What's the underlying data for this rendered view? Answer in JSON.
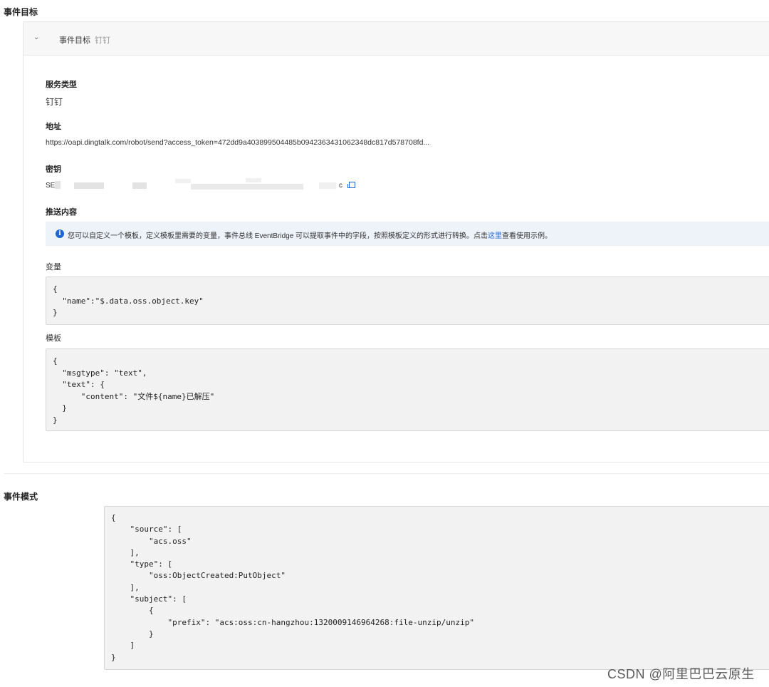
{
  "target_section": {
    "title": "事件目标",
    "panel": {
      "header_title": "事件目标",
      "header_sub": "钉钉",
      "service_type_label": "服务类型",
      "service_type_value": "钉钉",
      "address_label": "地址",
      "address_value": "https://oapi.dingtalk.com/robot/send?access_token=472dd9a403899504485b0942363431062348dc817d578708fd...",
      "secret_label": "密钥",
      "secret_prefix": "SE",
      "secret_suffix": "c",
      "push_content_label": "推送内容",
      "info_text_before": "您可以自定义一个模板，定义模板里需要的变量，事件总线 EventBridge 可以提取事件中的字段，按照模板定义的形式进行转换。点击",
      "info_link": "这里",
      "info_text_after": "查看使用示例。",
      "variables_label": "变量",
      "variables_code": "{\n  \"name\":\"$.data.oss.object.key\"\n}",
      "template_label": "模板",
      "template_code": "{\n  \"msgtype\": \"text\",\n  \"text\": {\n      \"content\": \"文件${name}已解压\"\n  }\n}"
    }
  },
  "pattern_section": {
    "title": "事件模式",
    "code": "{\n    \"source\": [\n        \"acs.oss\"\n    ],\n    \"type\": [\n        \"oss:ObjectCreated:PutObject\"\n    ],\n    \"subject\": [\n        {\n            \"prefix\": \"acs:oss:cn-hangzhou:1320009146964268:file-unzip/unzip\"\n        }\n    ]\n}"
  },
  "watermark": "CSDN @阿里巴巴云原生",
  "colors": {
    "link": "#1e64d2",
    "info_bg": "#eef2f9",
    "code_bg": "#f2f2f2"
  }
}
